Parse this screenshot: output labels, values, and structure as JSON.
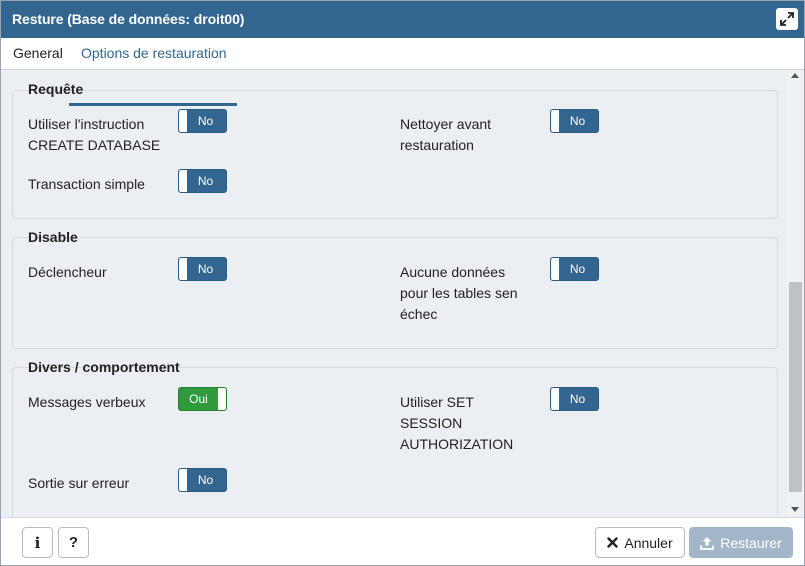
{
  "dialog": {
    "title": "Resture (Base de données: droit00)"
  },
  "tabs": [
    {
      "label": "General"
    },
    {
      "label": "Options de restauration"
    }
  ],
  "sections": {
    "requete": {
      "title": "Requête",
      "create_db": {
        "label_line1": "Utiliser l'instruction",
        "label_line2": "CREATE DATABASE",
        "value": "No"
      },
      "clean": {
        "label_line1": "Nettoyer avant",
        "label_line2": "restauration",
        "value": "No"
      },
      "single_tx": {
        "label": "Transaction simple",
        "value": "No"
      }
    },
    "disable": {
      "title": "Disable",
      "trigger": {
        "label": "Déclencheur",
        "value": "No"
      },
      "no_data": {
        "label_line1": "Aucune données",
        "label_line2": "pour les tables sen",
        "label_line3": "échec",
        "value": "No"
      }
    },
    "divers": {
      "title": "Divers / comportement",
      "verbose": {
        "label": "Messages verbeux",
        "value": "Oui"
      },
      "set_session": {
        "label_line1": "Utiliser SET",
        "label_line2": "SESSION",
        "label_line3": "AUTHORIZATION",
        "value": "No"
      },
      "exit_on_error": {
        "label": "Sortie sur erreur",
        "value": "No"
      }
    }
  },
  "footer": {
    "info_label": "i",
    "help_label": "?",
    "cancel_label": "Annuler",
    "restore_label": "Restaurer"
  },
  "colors": {
    "header": "#326690",
    "toggle_off": "#326690",
    "toggle_on": "#2e9a3c",
    "restore_disabled": "#a1b6c9"
  }
}
